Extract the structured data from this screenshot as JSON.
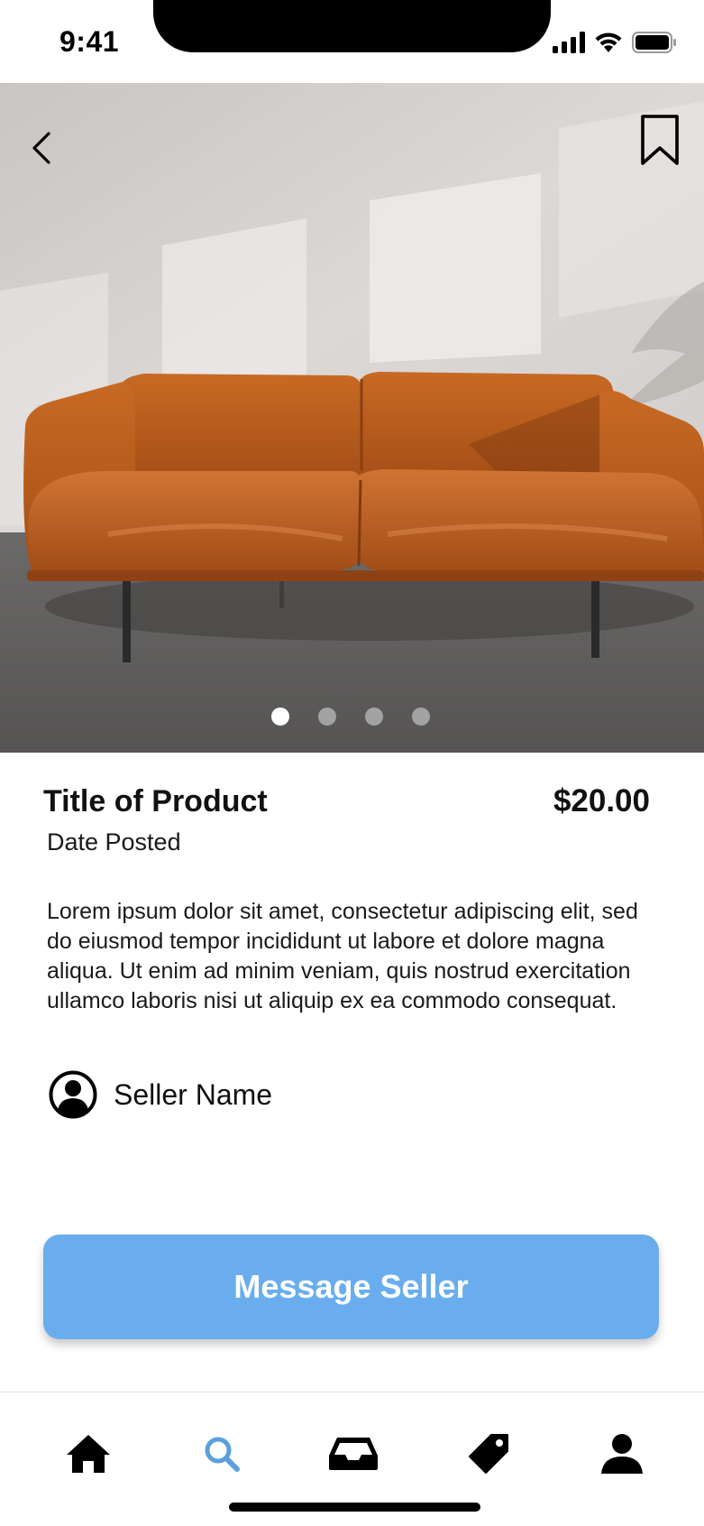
{
  "status_bar": {
    "time": "9:41"
  },
  "hero": {
    "slide_count": 4,
    "active_slide": 1
  },
  "product": {
    "title": "Title of Product",
    "price": "$20.00",
    "date_posted": "Date Posted",
    "description": "Lorem ipsum dolor sit amet, consectetur adipiscing elit, sed do eiusmod tempor incididunt ut labore et dolore magna aliqua. Ut enim ad minim veniam, quis nostrud exercitation ullamco laboris nisi ut aliquip ex ea commodo consequat."
  },
  "seller": {
    "name": "Seller Name",
    "icon": "user-circle-icon"
  },
  "cta": {
    "label": "Message Seller",
    "color": "#6aadee"
  },
  "tab_bar": {
    "active": "search",
    "active_color": "#5b9fdf",
    "tabs": [
      {
        "id": "home",
        "icon": "home-icon"
      },
      {
        "id": "search",
        "icon": "search-icon"
      },
      {
        "id": "inbox",
        "icon": "inbox-icon"
      },
      {
        "id": "tag",
        "icon": "tag-icon"
      },
      {
        "id": "profile",
        "icon": "profile-icon"
      }
    ]
  }
}
